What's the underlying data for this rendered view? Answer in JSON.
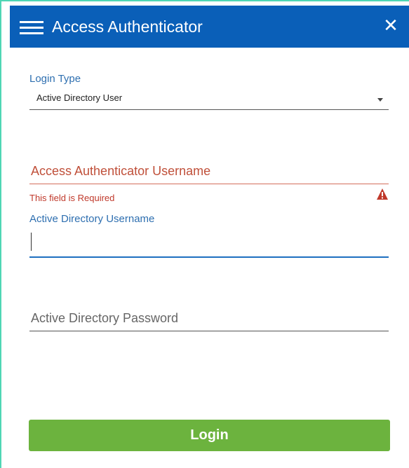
{
  "header": {
    "title": "Access Authenticator",
    "menu_icon": "hamburger-menu-icon",
    "close_icon": "close-icon",
    "close_glyph": "✕",
    "background_color": "#0a5fb8"
  },
  "form": {
    "login_type": {
      "label": "Login Type",
      "selected_value": "Active Directory User"
    },
    "access_authenticator_username": {
      "placeholder": "Access Authenticator Username",
      "value": "",
      "error": "This field is Required",
      "error_color": "#c0392b"
    },
    "active_directory_username": {
      "label": "Active Directory Username",
      "value": ""
    },
    "active_directory_password": {
      "placeholder": "Active Directory Password",
      "value": ""
    },
    "login_button": {
      "label": "Login",
      "color": "#6cb33e"
    }
  },
  "colors": {
    "window_border": "#4fd6b4",
    "label_blue": "#2e6fb0",
    "focus_underline": "#1e6fc0"
  }
}
